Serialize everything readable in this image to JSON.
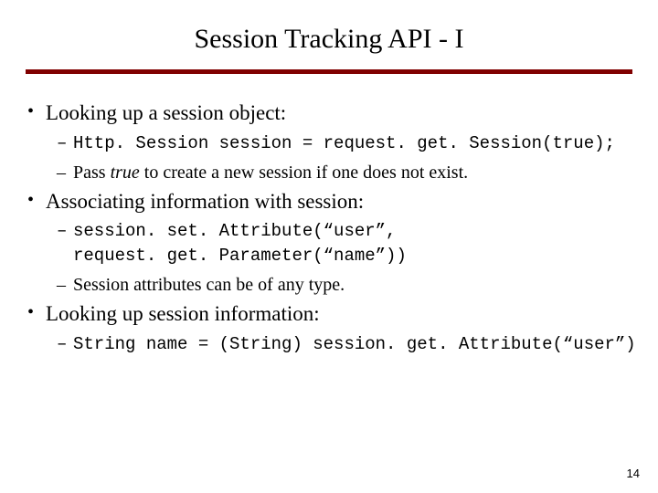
{
  "title": "Session Tracking API - I",
  "b1": {
    "text": "Looking up a session object:",
    "code": "Http. Session session = request. get. Session(true);",
    "note_pre": "Pass ",
    "note_em": "true",
    "note_post": " to create a new session if one does not exist."
  },
  "b2": {
    "text": "Associating information with session:",
    "code1": "session. set. Attribute(“user”,",
    "code2": "                   request. get. Parameter(“name”))",
    "note": "Session attributes can be of any type."
  },
  "b3": {
    "text": "Looking up session information:",
    "code": "String name = (String) session. get. Attribute(“user”)"
  },
  "page": "14"
}
